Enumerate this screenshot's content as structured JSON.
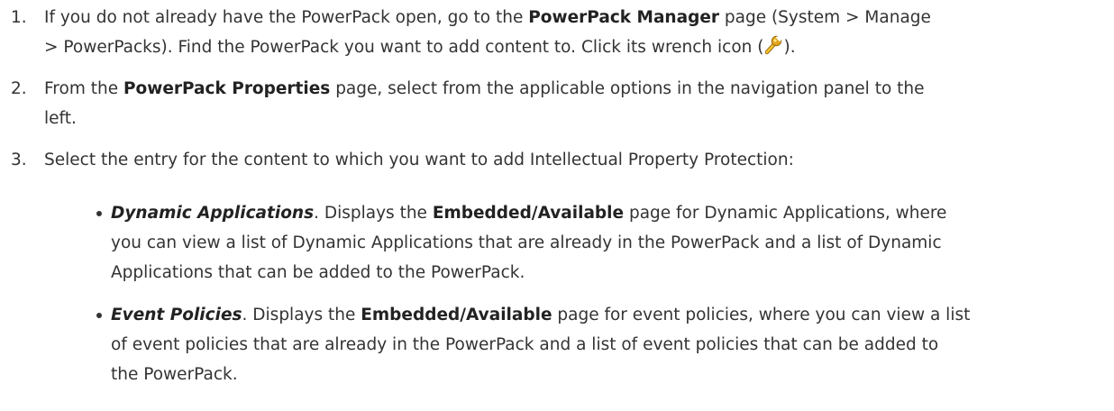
{
  "steps": [
    {
      "num": "1.",
      "lines": [
        {
          "a": "If you do not already have the PowerPack open, go to the ",
          "b": "PowerPack Manager",
          "c": " page (System > Manage"
        },
        {
          "a": "> PowerPacks). Find the PowerPack you want to add content to. Click its wrench icon (",
          "c": ")."
        }
      ],
      "icon": "wrench-icon"
    },
    {
      "num": "2.",
      "lines": [
        {
          "a": "From the ",
          "b": "PowerPack Properties",
          "c": " page, select from the applicable options in the navigation panel to the"
        },
        {
          "a": "left."
        }
      ]
    },
    {
      "num": "3.",
      "lines": [
        {
          "a": "Select the entry for the content to which you want to add Intellectual Property Protection:"
        }
      ]
    }
  ],
  "bullets": [
    {
      "term": "Dynamic Applications",
      "lines": [
        {
          "a": ". Displays the ",
          "b": "Embedded/Available",
          "c": " page for Dynamic Applications, where"
        },
        {
          "a": "you can view a list of Dynamic Applications that are already in the PowerPack and a list of Dynamic"
        },
        {
          "a": "Applications that can be added to the PowerPack."
        }
      ]
    },
    {
      "term": "Event Policies",
      "lines": [
        {
          "a": ". Displays the ",
          "b": "Embedded/Available",
          "c": " page for event policies, where you can view a list"
        },
        {
          "a": "of event policies that are already in the PowerPack and a list of event policies that can be added to"
        },
        {
          "a": "the PowerPack."
        }
      ]
    }
  ],
  "colors": {
    "text": "#333333",
    "wrench_gold": "#e2a51c"
  }
}
